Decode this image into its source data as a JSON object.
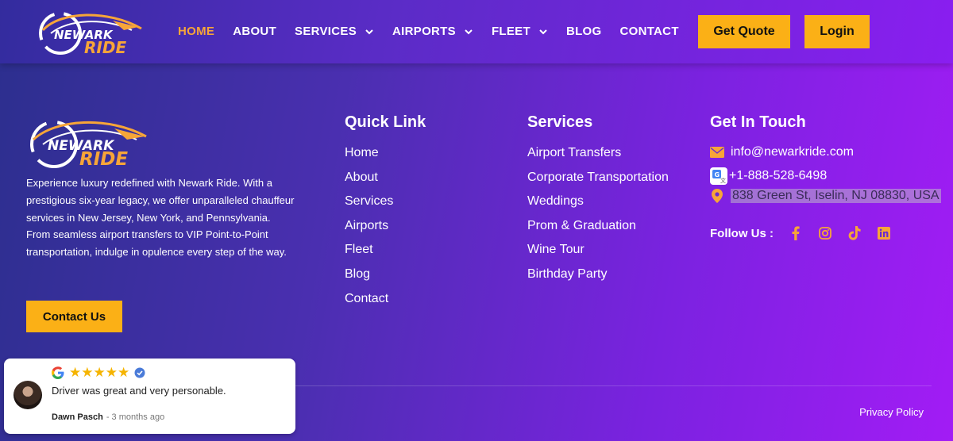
{
  "header": {
    "logo_line1": "NEWARK",
    "logo_line2": "RIDE",
    "nav": [
      {
        "label": "HOME",
        "active": true,
        "dropdown": false
      },
      {
        "label": "ABOUT",
        "active": false,
        "dropdown": false
      },
      {
        "label": "SERVICES",
        "active": false,
        "dropdown": true
      },
      {
        "label": "AIRPORTS",
        "active": false,
        "dropdown": true
      },
      {
        "label": "FLEET",
        "active": false,
        "dropdown": true
      },
      {
        "label": "BLOG",
        "active": false,
        "dropdown": false
      },
      {
        "label": "CONTACT",
        "active": false,
        "dropdown": false
      }
    ],
    "get_quote_label": "Get Quote",
    "login_label": "Login"
  },
  "footer": {
    "logo_line1": "NEWARK",
    "logo_line2": "RIDE",
    "about_text": "Experience luxury redefined with Newark Ride. With a prestigious six-year legacy, we offer unparalleled chauffeur services in New Jersey, New York, and Pennsylvania. From seamless airport transfers to VIP Point-to-Point transportation, indulge in opulence every step of the way.",
    "contact_button": "Contact Us",
    "quick_link": {
      "title": "Quick Link",
      "items": [
        "Home",
        "About",
        "Services",
        "Airports",
        "Fleet",
        "Blog",
        "Contact"
      ]
    },
    "services": {
      "title": "Services",
      "items": [
        "Airport Transfers",
        "Corporate Transportation",
        "Weddings",
        "Prom & Graduation",
        "Wine Tour",
        "Birthday Party"
      ]
    },
    "get_in_touch": {
      "title": "Get In Touch",
      "email": "info@newarkride.com",
      "phone": "+1-888-528-6498",
      "address": "838 Green St, Iselin, NJ 08830, USA",
      "follow_label": "Follow Us :",
      "socials": [
        "facebook-icon",
        "instagram-icon",
        "tiktok-icon",
        "linkedin-icon"
      ]
    },
    "privacy_label": "Privacy Policy"
  },
  "review": {
    "rating": 5,
    "text": "Driver was great and very personable.",
    "author": "Dawn Pasch",
    "time": "- 3 months ago"
  },
  "colors": {
    "accent": "#fbb016",
    "active_nav": "#f7a538",
    "star": "#f5b400"
  }
}
